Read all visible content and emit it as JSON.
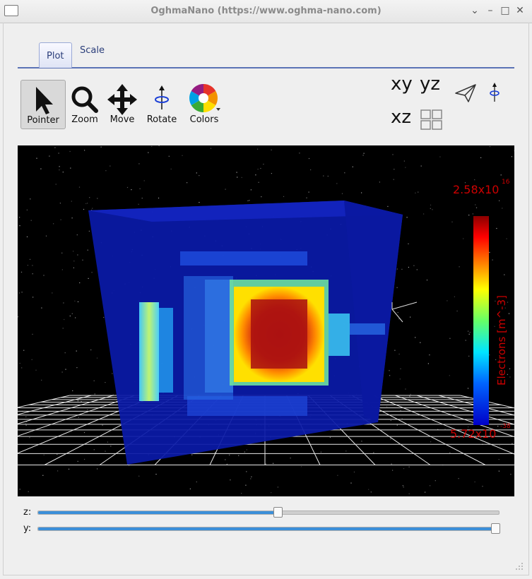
{
  "window": {
    "title": "OghmaNano (https://www.oghma-nano.com)"
  },
  "tabs": [
    {
      "label": "Plot"
    },
    {
      "label": "Scale"
    }
  ],
  "toolbar": {
    "pointer": "Pointer",
    "zoom": "Zoom",
    "move": "Move",
    "rotate": "Rotate",
    "colors": "Colors",
    "view_xy": "xy",
    "view_yz": "yz",
    "view_xz": "xz"
  },
  "plot": {
    "colorbar_max": "2.58x10",
    "colorbar_max_exp": "16",
    "colorbar_min": "5.72x10",
    "colorbar_min_exp": "-38",
    "colorbar_label": "Electrons [m^-3]",
    "colors": {
      "label": "#cc0000",
      "cube": "#0a1aa8"
    }
  },
  "sliders": {
    "z": {
      "label": "z:",
      "value": 0.52
    },
    "y": {
      "label": "y:",
      "value": 1.0
    }
  }
}
